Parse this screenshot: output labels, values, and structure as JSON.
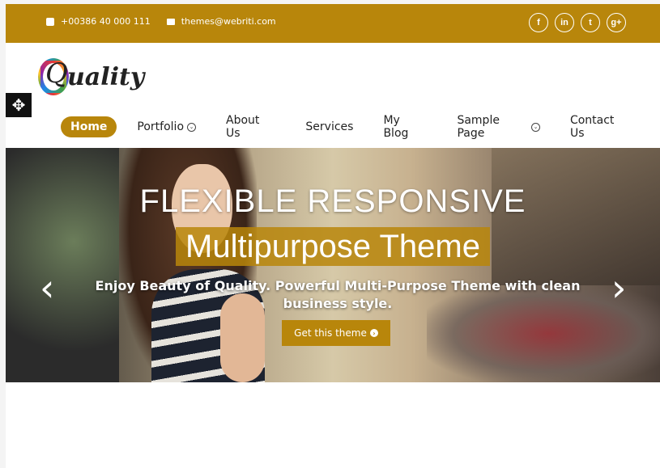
{
  "topbar": {
    "phone": "+00386 40 000 111",
    "email": "themes@webriti.com",
    "social": [
      "f",
      "in",
      "t",
      "g+"
    ]
  },
  "logo": {
    "letter": "Q",
    "rest": "uality"
  },
  "nav": {
    "items": [
      {
        "label": "Home",
        "active": true
      },
      {
        "label": "Portfolio",
        "dropdown": true
      },
      {
        "label": "About Us"
      },
      {
        "label": "Services"
      },
      {
        "label": "My Blog"
      },
      {
        "label": "Sample Page",
        "dropdown": true
      },
      {
        "label": "Contact Us"
      }
    ]
  },
  "hero": {
    "title": "FLEXIBLE RESPONSIVE",
    "highlight": "Multipurpose Theme",
    "subtitle": "Enjoy Beauty of Quality. Powerful Multi-Purpose Theme with clean business style.",
    "button": "Get this theme",
    "prev": "‹",
    "next": "›"
  },
  "icons": {
    "move": "move-icon"
  },
  "colors": {
    "accent": "#b8860b"
  }
}
